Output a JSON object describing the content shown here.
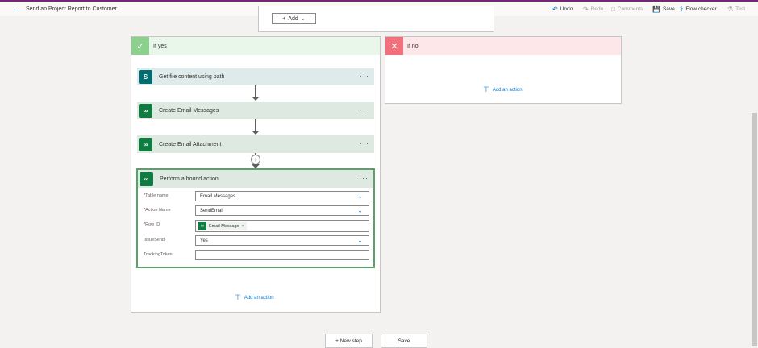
{
  "header": {
    "title": "Send an Project Report to Customer",
    "commands": [
      {
        "label": "Undo",
        "icon": "undo-icon",
        "enabled": true
      },
      {
        "label": "Redo",
        "icon": "redo-icon",
        "enabled": false
      },
      {
        "label": "Comments",
        "icon": "comment-icon",
        "enabled": false
      },
      {
        "label": "Save",
        "icon": "save-icon",
        "enabled": true
      },
      {
        "label": "Flow checker",
        "icon": "stethoscope-icon",
        "enabled": true
      },
      {
        "label": "Test",
        "icon": "flask-icon",
        "enabled": false
      }
    ]
  },
  "top_card": {
    "add_label": "Add"
  },
  "branch_yes": {
    "label": "If yes",
    "actions": [
      {
        "title": "Get file content using path",
        "icon": "sharepoint-icon"
      },
      {
        "title": "Create Email Messages",
        "icon": "dataverse-icon"
      },
      {
        "title": "Create Email Attachment",
        "icon": "dataverse-icon"
      }
    ],
    "expanded_action": {
      "title": "Perform a bound action",
      "fields": [
        {
          "label": "Table name",
          "required": true,
          "value": "Email Messages",
          "type": "dropdown"
        },
        {
          "label": "Action Name",
          "required": true,
          "value": "SendEmail",
          "type": "dropdown"
        },
        {
          "label": "Row ID",
          "required": true,
          "token": "Email Message",
          "type": "token"
        },
        {
          "label": "IssueSend",
          "required": false,
          "value": "Yes",
          "type": "dropdown"
        },
        {
          "label": "TrackingToken",
          "required": false,
          "value": "",
          "type": "text"
        }
      ]
    },
    "add_action_label": "Add an action"
  },
  "branch_no": {
    "label": "If no",
    "add_action_label": "Add an action"
  },
  "bottom": {
    "new_step_label": "+ New step",
    "save_label": "Save"
  },
  "colors": {
    "accent": "#0078d4",
    "yes_green": "#8cd08e",
    "no_red": "#f1707b",
    "dataverse_green": "#107c41",
    "sharepoint_teal": "#036c70"
  }
}
